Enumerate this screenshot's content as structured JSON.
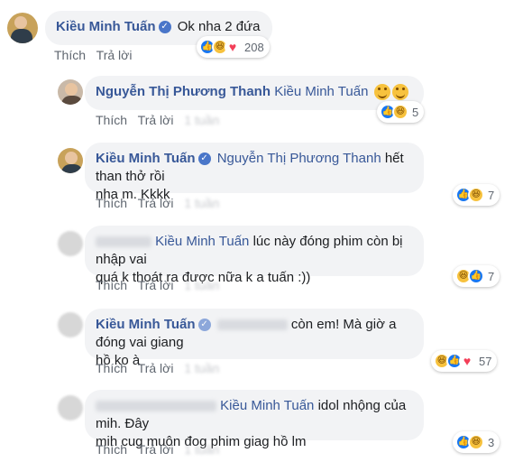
{
  "comments": [
    {
      "author": "Kiều Minh Tuấn",
      "verified": true,
      "text": "Ok nha 2 đứa",
      "actions": {
        "like": "Thích",
        "reply": "Trả lời"
      },
      "reactions": {
        "types": [
          "like",
          "haha",
          "love"
        ],
        "count": "208"
      }
    },
    {
      "author": "Nguyễn Thị Phương Thanh",
      "mention": "Kiều Minh Tuấn",
      "actions": {
        "like": "Thích",
        "reply": "Trả lời",
        "time": "1 tuần"
      },
      "reactions": {
        "types": [
          "like",
          "haha"
        ],
        "count": "5"
      }
    },
    {
      "author": "Kiều Minh Tuấn",
      "verified": true,
      "mention": "Nguyễn Thị Phương Thanh",
      "text_line1": "hết than thở rồi",
      "text_line2": "nha m. Kkkk",
      "actions": {
        "like": "Thích",
        "reply": "Trả lời",
        "time": "1 tuần"
      },
      "reactions": {
        "types": [
          "like",
          "haha"
        ],
        "count": "7"
      }
    },
    {
      "mention": "Kiều Minh Tuấn",
      "text_line1": "lúc này đóng phim còn bị nhập vai",
      "text_line2": "quá k thoát ra được nữa k a tuấn :))",
      "actions": {
        "like": "Thích",
        "reply": "Trả lời",
        "time": "1 tuần"
      },
      "reactions": {
        "types": [
          "haha",
          "like"
        ],
        "count": "7"
      }
    },
    {
      "author": "Kiều Minh Tuấn",
      "verified": true,
      "text_line1": "còn em! Mà giờ a đóng vai giang",
      "text_line2": "hồ ko à",
      "actions": {
        "like": "Thích",
        "reply": "Trả lời",
        "time": "1 tuần"
      },
      "reactions": {
        "types": [
          "haha",
          "like",
          "love"
        ],
        "count": "57"
      }
    },
    {
      "mention": "Kiều Minh Tuấn",
      "text_line1": "idol nhộng của mih. Đây",
      "text_line2": "mih cug muôn đog phim giag hồ lm",
      "actions": {
        "like": "Thích",
        "reply": "Trả lời",
        "time": "1 tuần"
      },
      "reactions": {
        "types": [
          "like",
          "haha"
        ],
        "count": "3"
      }
    }
  ],
  "colors": {
    "name": "#385898",
    "bubble": "#f2f3f5",
    "like": "#1877f2",
    "haha": "#f7c23e",
    "love": "#f33e58"
  }
}
